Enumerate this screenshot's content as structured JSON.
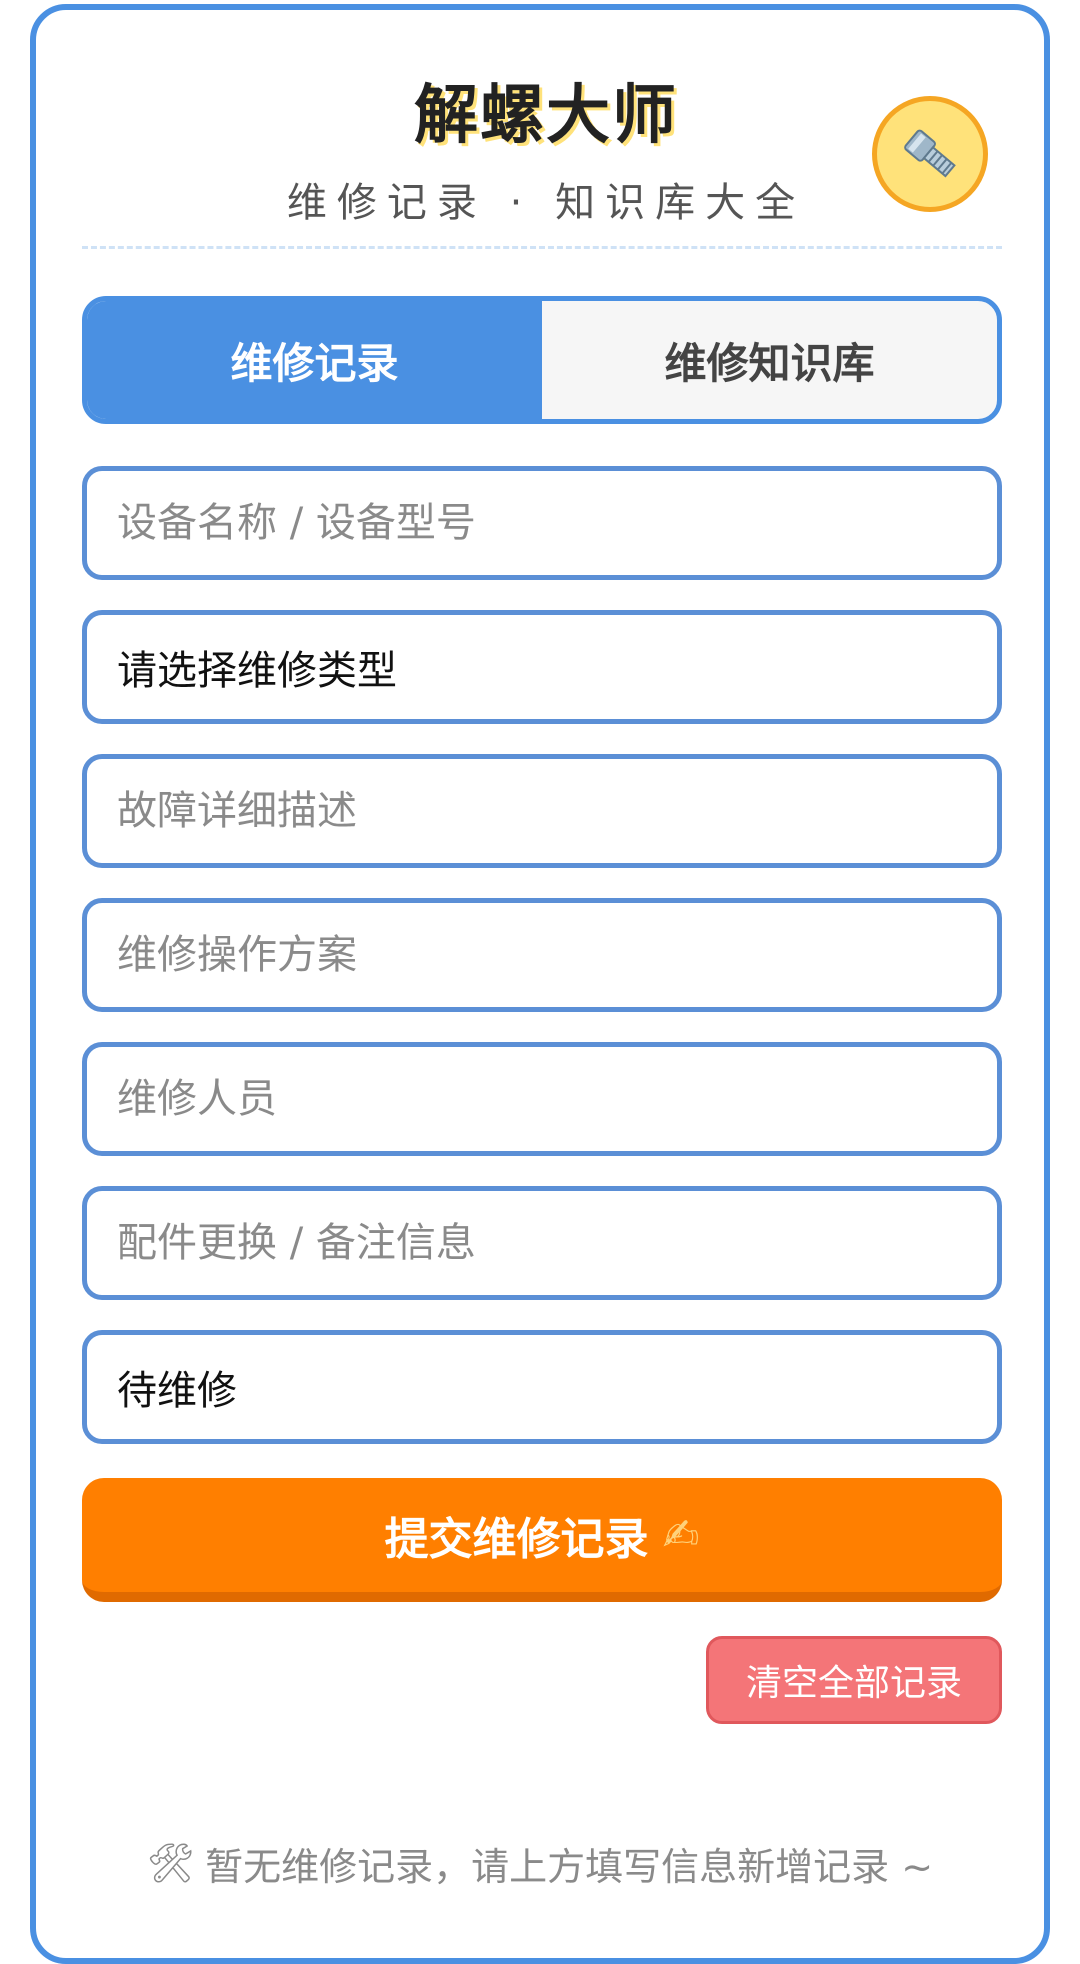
{
  "header": {
    "title": "解螺大师",
    "subtitle": "维修记录 · 知识库大全",
    "logo_icon": "bolt-icon"
  },
  "tabs": [
    {
      "label": "维修记录",
      "active": true
    },
    {
      "label": "维修知识库",
      "active": false
    }
  ],
  "form": {
    "device_placeholder": "设备名称 / 设备型号",
    "repair_type_value": "请选择维修类型",
    "fault_placeholder": "故障详细描述",
    "plan_placeholder": "维修操作方案",
    "person_placeholder": "维修人员",
    "parts_placeholder": "配件更换 / 备注信息",
    "status_value": "待维修"
  },
  "actions": {
    "submit_label": "提交维修记录",
    "submit_icon": "✍",
    "clear_label": "清空全部记录"
  },
  "empty_state": {
    "icon": "🛠",
    "text": "暂无维修记录，请上方填写信息新增记录 ~"
  },
  "colors": {
    "accent": "#4a90e2",
    "submit": "#ff7f00",
    "danger": "#f47578",
    "logo_bg": "#ffe27a"
  }
}
